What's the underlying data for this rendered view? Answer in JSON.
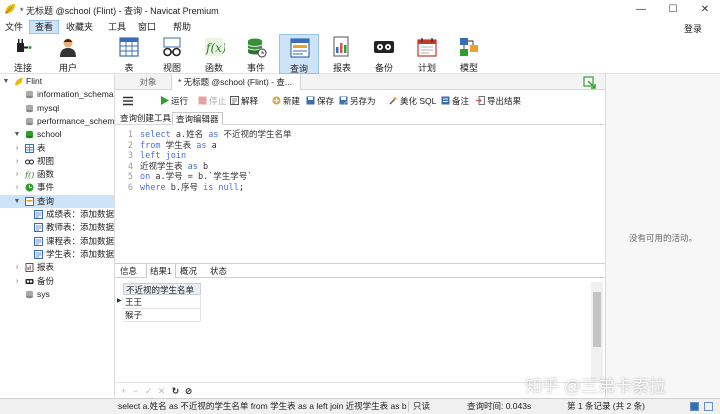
{
  "window": {
    "title": "* 无标题 @school (Flint) - 查询 - Navicat Premium",
    "app_icon": "navicat-leaf-icon",
    "controls": [
      "minimize",
      "maximize",
      "close"
    ]
  },
  "menu": {
    "items": [
      "文件",
      "查看",
      "收藏夹",
      "工具",
      "窗口",
      "帮助"
    ],
    "active": "查看",
    "login": "登录"
  },
  "toolbar": {
    "buttons": [
      {
        "label": "连接",
        "icon": "plug-connect-icon"
      },
      {
        "label": "用户",
        "icon": "user-icon"
      },
      {
        "label": "表",
        "icon": "table-icon"
      },
      {
        "label": "视图",
        "icon": "view-glasses-icon"
      },
      {
        "label": "函数",
        "icon": "function-fx-icon"
      },
      {
        "label": "事件",
        "icon": "event-database-icon"
      },
      {
        "label": "查询",
        "icon": "query-icon",
        "active": true
      },
      {
        "label": "报表",
        "icon": "report-icon"
      },
      {
        "label": "备份",
        "icon": "backup-icon"
      },
      {
        "label": "计划",
        "icon": "schedule-calendar-icon"
      },
      {
        "label": "模型",
        "icon": "model-icon"
      }
    ]
  },
  "navtree": {
    "items": [
      {
        "label": "Flint",
        "level": 0,
        "icon": "connection-leaf-icon",
        "arrow": "▼"
      },
      {
        "label": "information_schema",
        "level": 1,
        "icon": "database-icon",
        "arrow": ""
      },
      {
        "label": "mysql",
        "level": 1,
        "icon": "database-icon",
        "arrow": ""
      },
      {
        "label": "performance_schema",
        "level": 1,
        "icon": "database-icon",
        "arrow": ""
      },
      {
        "label": "school",
        "level": 1,
        "icon": "database-open-icon",
        "arrow": "▼"
      },
      {
        "label": "表",
        "level": 2,
        "icon": "table-icon",
        "arrow": "›"
      },
      {
        "label": "视图",
        "level": 2,
        "icon": "view-glasses-icon",
        "arrow": "›"
      },
      {
        "label": "函数",
        "level": 2,
        "icon": "function-fx-icon",
        "arrow": "›"
      },
      {
        "label": "事件",
        "level": 2,
        "icon": "event-icon",
        "arrow": "›"
      },
      {
        "label": "查询",
        "level": 2,
        "icon": "query-icon",
        "arrow": "▼",
        "selected": true
      },
      {
        "label": "成绩表：添加数据",
        "level": 3,
        "icon": "query-item-icon",
        "arrow": ""
      },
      {
        "label": "教师表：添加数据",
        "level": 3,
        "icon": "query-item-icon",
        "arrow": ""
      },
      {
        "label": "课程表：添加数据",
        "level": 3,
        "icon": "query-item-icon",
        "arrow": ""
      },
      {
        "label": "学生表：添加数据",
        "level": 3,
        "icon": "query-item-icon",
        "arrow": ""
      },
      {
        "label": "报表",
        "level": 2,
        "icon": "report-icon",
        "arrow": "›"
      },
      {
        "label": "备份",
        "level": 2,
        "icon": "backup-icon",
        "arrow": "›"
      },
      {
        "label": "sys",
        "level": 1,
        "icon": "database-icon",
        "arrow": ""
      }
    ]
  },
  "tabs": {
    "object": "对象",
    "query": "* 无标题 @school (Flint) - 查..."
  },
  "query_toolbar": {
    "run": "运行",
    "stop": "停止",
    "explain": "解释",
    "new": "新建",
    "save": "保存",
    "save_as": "另存为",
    "beautify": "美化 SQL",
    "note": "备注",
    "export": "导出结果"
  },
  "subtabs": [
    "查询创建工具",
    "查询编辑器"
  ],
  "editor": {
    "lines": [
      {
        "n": "1",
        "parts": [
          [
            "kw",
            "select "
          ],
          [
            "id",
            "a.姓名 "
          ],
          [
            "kw",
            "as "
          ],
          [
            "id",
            "不近视的学生名单"
          ]
        ]
      },
      {
        "n": "2",
        "parts": [
          [
            "kw",
            "from "
          ],
          [
            "id",
            "学生表 "
          ],
          [
            "kw",
            "as "
          ],
          [
            "id",
            "a"
          ]
        ]
      },
      {
        "n": "3",
        "parts": [
          [
            "kw",
            "left join"
          ]
        ]
      },
      {
        "n": "4",
        "parts": [
          [
            "id",
            "近视学生表 "
          ],
          [
            "kw",
            "as "
          ],
          [
            "id",
            "b"
          ]
        ]
      },
      {
        "n": "5",
        "parts": [
          [
            "kw",
            "on "
          ],
          [
            "id",
            "a.学号 = b.`学生学号`"
          ]
        ]
      },
      {
        "n": "6",
        "parts": [
          [
            "kw",
            "where "
          ],
          [
            "id",
            "b.序号 "
          ],
          [
            "kw",
            "is null"
          ],
          [
            "id",
            ";"
          ]
        ]
      }
    ]
  },
  "result_tabs": [
    "信息",
    "结果1",
    "概况",
    "状态"
  ],
  "result_active": "结果1",
  "grid": {
    "column": "不近视的学生名单",
    "rows": [
      "王王",
      "猴子"
    ]
  },
  "right_panel": {
    "empty_text": "没有可用的活动。"
  },
  "statusbar": {
    "sql": "select a.姓名 as 不近视的学生名单 from 学生表 as a  left join 近视学生表 as b",
    "mode": "只读",
    "time": "查询时间: 0.043s",
    "records": "第 1 条记录 (共 2 条)"
  },
  "watermark": "知乎 @三弟卡索拉",
  "colors": {
    "keyword": "#4a6fd6",
    "selection": "#cde3f7",
    "run_green": "#2ca02c",
    "stop_red": "#d9534f"
  }
}
